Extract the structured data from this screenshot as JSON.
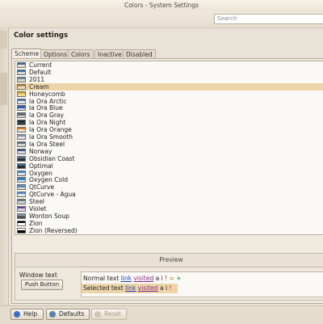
{
  "window": {
    "title": "Colors - System Settings"
  },
  "search": {
    "placeholder": "Search"
  },
  "page": {
    "title": "Color settings"
  },
  "tabs": [
    "Scheme",
    "Options",
    "Colors",
    "Inactive",
    "Disabled"
  ],
  "active_tab": "Scheme",
  "schemes": [
    {
      "name": "Current",
      "bg": "#e3dccf",
      "band": "#3a6ea5"
    },
    {
      "name": "Default",
      "bg": "#d6d6d6",
      "band": "#3b6ea8"
    },
    {
      "name": "2011",
      "bg": "#d9d4cc",
      "band": "#6b87a8"
    },
    {
      "name": "Cream",
      "bg": "#eadfc8",
      "band": "#b58b4c"
    },
    {
      "name": "Honeycomb",
      "bg": "#f0d98a",
      "band": "#d9a21e"
    },
    {
      "name": "la Ora Arctic",
      "bg": "#e2e8ee",
      "band": "#4f7ca8"
    },
    {
      "name": "la Ora Blue",
      "bg": "#d6dde6",
      "band": "#2a5caa"
    },
    {
      "name": "la Ora Gray",
      "bg": "#d4d4d4",
      "band": "#5f6b78"
    },
    {
      "name": "la Ora Night",
      "bg": "#3b4048",
      "band": "#1c2633"
    },
    {
      "name": "la Ora Orange",
      "bg": "#e8ddd0",
      "band": "#e07a1f"
    },
    {
      "name": "la Ora Smooth",
      "bg": "#e2e2e2",
      "band": "#8b98a8"
    },
    {
      "name": "la Ora Steel",
      "bg": "#cfd5da",
      "band": "#5c6f80"
    },
    {
      "name": "Norway",
      "bg": "#d8dde2",
      "band": "#2f4f7f"
    },
    {
      "name": "Obsidian Coast",
      "bg": "#2d3036",
      "band": "#5d7b9d"
    },
    {
      "name": "Optimal",
      "bg": "#2b2b2b",
      "band": "#3f6fa0"
    },
    {
      "name": "Oxygen",
      "bg": "#e0dfde",
      "band": "#3d8bd6"
    },
    {
      "name": "Oxygen Cold",
      "bg": "#dfe3e8",
      "band": "#3a7cc2"
    },
    {
      "name": "QtCurve",
      "bg": "#e0ddd8",
      "band": "#5a8ac0"
    },
    {
      "name": "QtCurve - Agua",
      "bg": "#e6e6e6",
      "band": "#4a90d9"
    },
    {
      "name": "Steel",
      "bg": "#cfd3d6",
      "band": "#6a7b8a"
    },
    {
      "name": "Violet",
      "bg": "#ddd5e6",
      "band": "#6b3fa0"
    },
    {
      "name": "Wonton Soup",
      "bg": "#4c5258",
      "band": "#8aa0b0"
    },
    {
      "name": "Zion",
      "bg": "#ffffff",
      "band": "#000000"
    },
    {
      "name": "Zion (Reversed)",
      "bg": "#000000",
      "band": "#ffffff"
    }
  ],
  "selected_scheme": "Cream",
  "preview": {
    "header": "Preview",
    "window_text": "Window text",
    "push_button": "Push Button",
    "normal_text": "Normal text",
    "selected_text": "Selected text",
    "link": "link",
    "visited": "visited",
    "active": "a",
    "inactive": "i",
    "negative": "!",
    "neutral": "=",
    "positive": "+"
  },
  "buttons": {
    "help": "Help",
    "defaults": "Defaults",
    "reset": "Reset"
  },
  "colors": {
    "selection": "#edd5a9",
    "accent": "#3a6ea5"
  }
}
